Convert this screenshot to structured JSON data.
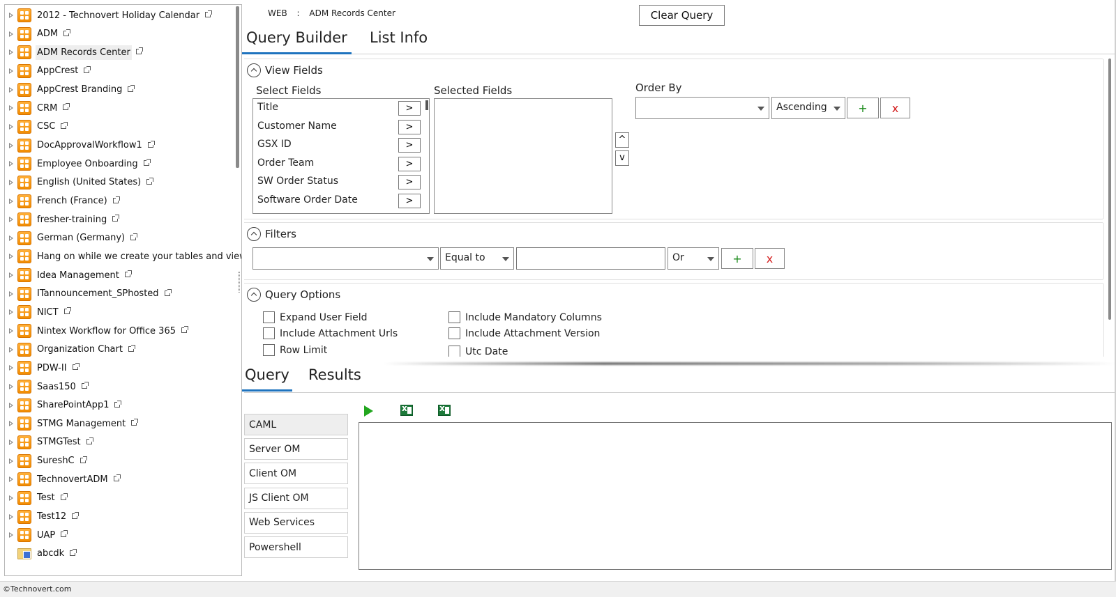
{
  "sidebar": {
    "items": [
      {
        "label": "2012 - Technovert Holiday Calendar",
        "icon": "site-icon"
      },
      {
        "label": "ADM",
        "icon": "site-icon"
      },
      {
        "label": "ADM Records Center",
        "icon": "site-icon",
        "selected": true
      },
      {
        "label": "AppCrest",
        "icon": "site-icon"
      },
      {
        "label": "AppCrest Branding",
        "icon": "site-icon"
      },
      {
        "label": "CRM",
        "icon": "site-icon"
      },
      {
        "label": "CSC",
        "icon": "site-icon"
      },
      {
        "label": "DocApprovalWorkflow1",
        "icon": "site-icon"
      },
      {
        "label": "Employee Onboarding",
        "icon": "site-icon"
      },
      {
        "label": "English (United States)",
        "icon": "site-icon"
      },
      {
        "label": "French (France)",
        "icon": "site-icon"
      },
      {
        "label": "fresher-training",
        "icon": "site-icon"
      },
      {
        "label": "German (Germany)",
        "icon": "site-icon"
      },
      {
        "label": "Hang on while we create your tables and views.",
        "icon": "site-icon"
      },
      {
        "label": "Idea Management",
        "icon": "site-icon"
      },
      {
        "label": "ITannouncement_SPhosted",
        "icon": "site-icon"
      },
      {
        "label": "NICT",
        "icon": "site-icon"
      },
      {
        "label": "Nintex Workflow for Office 365",
        "icon": "site-icon"
      },
      {
        "label": "Organization Chart",
        "icon": "site-icon"
      },
      {
        "label": "PDW-II",
        "icon": "site-icon"
      },
      {
        "label": "Saas150",
        "icon": "site-icon"
      },
      {
        "label": "SharePointApp1",
        "icon": "site-icon"
      },
      {
        "label": "STMG Management",
        "icon": "site-icon"
      },
      {
        "label": "STMGTest",
        "icon": "site-icon"
      },
      {
        "label": "SureshC",
        "icon": "site-icon"
      },
      {
        "label": "TechnovertADM",
        "icon": "site-icon"
      },
      {
        "label": "Test",
        "icon": "site-icon"
      },
      {
        "label": "Test12",
        "icon": "site-icon"
      },
      {
        "label": "UAP",
        "icon": "site-icon"
      },
      {
        "label": "abcdk",
        "icon": "folder-icon",
        "no_expander": true
      }
    ]
  },
  "header": {
    "scope": "WEB",
    "separator": ":",
    "site": "ADM Records Center",
    "clear_query": "Clear Query"
  },
  "tabs": [
    "Query Builder",
    "List Info"
  ],
  "view_fields": {
    "title": "View Fields",
    "select_label": "Select Fields",
    "selected_label": "Selected Fields",
    "fields": [
      "Title",
      "Customer Name",
      "GSX ID",
      "Order Team",
      "SW Order Status",
      "Software Order Date"
    ],
    "add_symbol": ">",
    "move_up": "^",
    "move_down": "v",
    "order_by_label": "Order By",
    "order_by_value": "",
    "direction": "Ascending",
    "plus": "+",
    "remove": "x"
  },
  "filters": {
    "title": "Filters",
    "field_value": "",
    "operator": "Equal to",
    "value": "",
    "conjunction": "Or",
    "plus": "+",
    "remove": "x"
  },
  "query_options": {
    "title": "Query Options",
    "left": [
      "Expand User Field",
      "Include Attachment Urls",
      "Row Limit"
    ],
    "right": [
      "Include Mandatory Columns",
      "Include Attachment Version",
      "Utc Date"
    ]
  },
  "bottom_tabs": [
    "Query",
    "Results"
  ],
  "languages": [
    "CAML",
    "Server OM",
    "Client OM",
    "JS Client OM",
    "Web Services",
    "Powershell"
  ],
  "footer": "©Technovert.com",
  "colors": {
    "accent": "#1e73be",
    "site_icon": "#f08a00",
    "run": "#22a61f",
    "excel": "#1d7a3a"
  }
}
